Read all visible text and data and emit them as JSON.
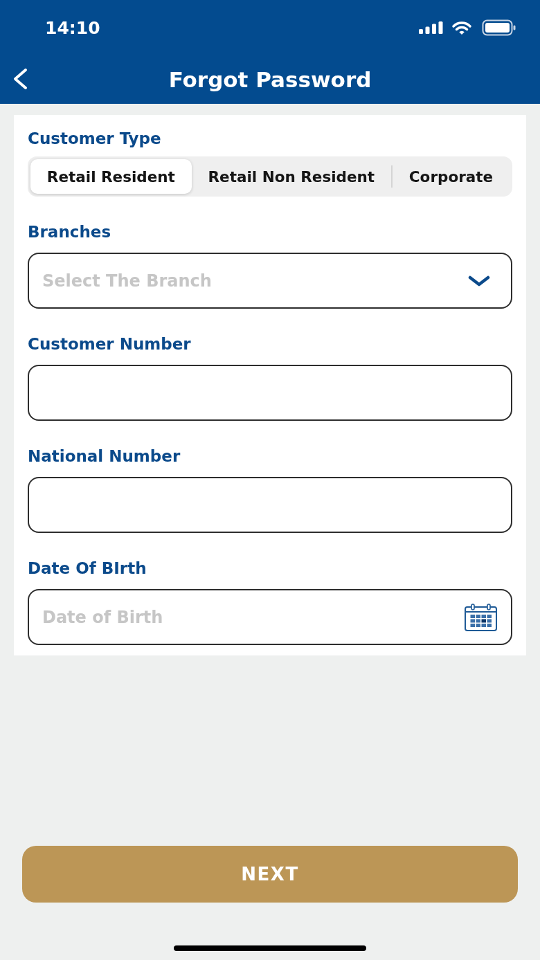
{
  "status_bar": {
    "time": "14:10"
  },
  "header": {
    "title": "Forgot Password"
  },
  "form": {
    "customer_type": {
      "label": "Customer Type",
      "options": [
        {
          "label": "Retail Resident",
          "selected": true
        },
        {
          "label": "Retail Non Resident",
          "selected": false
        },
        {
          "label": "Corporate",
          "selected": false
        }
      ]
    },
    "fields": [
      {
        "kind": "dropdown",
        "label": "Branches",
        "placeholder": "Select The Branch"
      },
      {
        "kind": "text",
        "label": "Customer Number"
      },
      {
        "kind": "text",
        "label": "National Number"
      },
      {
        "kind": "date",
        "label": "Date Of BIrth",
        "placeholder": "Date of Birth"
      }
    ]
  },
  "next_button": {
    "label": "NEXT"
  }
}
